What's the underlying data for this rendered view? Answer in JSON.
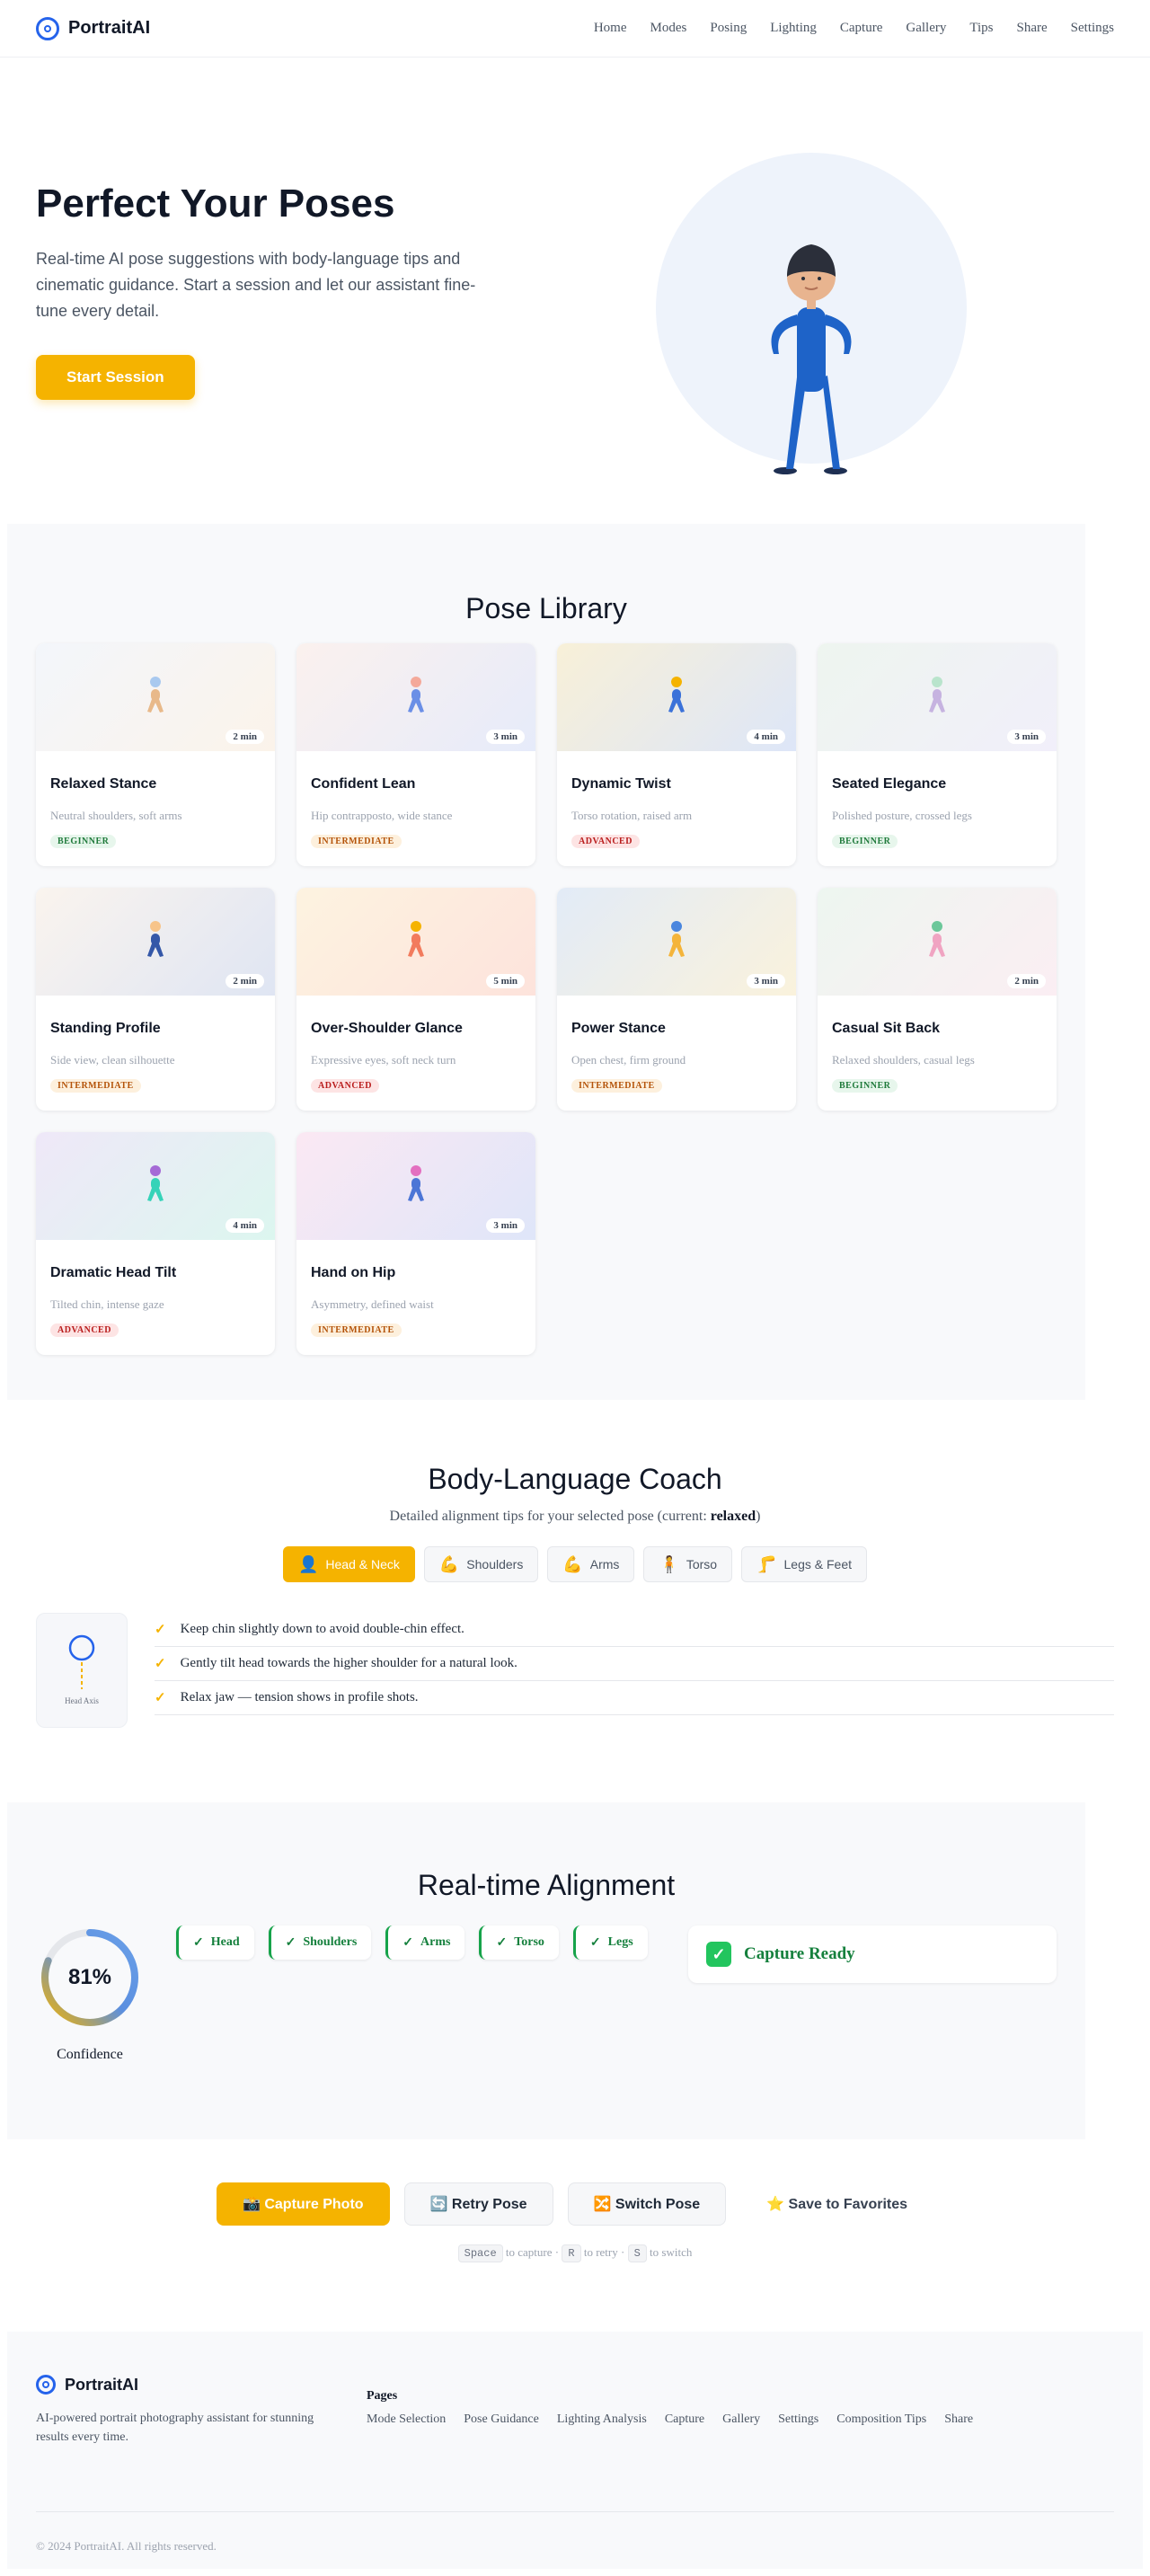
{
  "nav": {
    "brand": "PortraitAI",
    "links": [
      "Home",
      "Modes",
      "Posing",
      "Lighting",
      "Capture",
      "Gallery",
      "Tips",
      "Share",
      "Settings"
    ]
  },
  "hero": {
    "title": "Perfect Your Poses",
    "description": "Real-time AI pose suggestions with body-language tips and cinematic guidance. Start a session and let our assistant fine-tune every detail.",
    "cta": "Start Session"
  },
  "library": {
    "title": "Pose Library",
    "cards": [
      {
        "title": "Relaxed Stance",
        "desc": "Neutral shoulders, soft arms",
        "level": "BEGINNER",
        "duration": "2 min",
        "bg": [
          "#f3f6fb",
          "#fbf3ea"
        ],
        "head": "#a9c9ef",
        "body": "#e8b98a"
      },
      {
        "title": "Confident Lean",
        "desc": "Hip contrapposto, wide stance",
        "level": "INTERMEDIATE",
        "duration": "3 min",
        "bg": [
          "#fbf1ee",
          "#e6ebfa"
        ],
        "head": "#f4a99a",
        "body": "#6b8fe6"
      },
      {
        "title": "Dynamic Twist",
        "desc": "Torso rotation, raised arm",
        "level": "ADVANCED",
        "duration": "4 min",
        "bg": [
          "#f8f0d8",
          "#dde6f8"
        ],
        "head": "#f5b300",
        "body": "#3b72d9"
      },
      {
        "title": "Seated Elegance",
        "desc": "Polished posture, crossed legs",
        "level": "BEGINNER",
        "duration": "3 min",
        "bg": [
          "#eef5ef",
          "#f1effa"
        ],
        "head": "#b9e4cc",
        "body": "#c6b3e0"
      },
      {
        "title": "Standing Profile",
        "desc": "Side view, clean silhouette",
        "level": "INTERMEDIATE",
        "duration": "2 min",
        "bg": [
          "#faf4ee",
          "#dfe5f3"
        ],
        "head": "#f7c48a",
        "body": "#3457a8"
      },
      {
        "title": "Over-Shoulder Glance",
        "desc": "Expressive eyes, soft neck turn",
        "level": "ADVANCED",
        "duration": "5 min",
        "bg": [
          "#fdf3e0",
          "#fde3dc"
        ],
        "head": "#f5b300",
        "body": "#f27b5d"
      },
      {
        "title": "Power Stance",
        "desc": "Open chest, firm ground",
        "level": "INTERMEDIATE",
        "duration": "3 min",
        "bg": [
          "#e2ebf7",
          "#faf2dc"
        ],
        "head": "#4a86de",
        "body": "#f4b43a"
      },
      {
        "title": "Casual Sit Back",
        "desc": "Relaxed shoulders, casual legs",
        "level": "BEGINNER",
        "duration": "2 min",
        "bg": [
          "#edf6f0",
          "#fbeef3"
        ],
        "head": "#6cc79a",
        "body": "#f0a4c2"
      },
      {
        "title": "Dramatic Head Tilt",
        "desc": "Tilted chin, intense gaze",
        "level": "ADVANCED",
        "duration": "4 min",
        "bg": [
          "#efe8f8",
          "#dcf6ef"
        ],
        "head": "#a56ad6",
        "body": "#35d3b8"
      },
      {
        "title": "Hand on Hip",
        "desc": "Asymmetry, defined waist",
        "level": "INTERMEDIATE",
        "duration": "3 min",
        "bg": [
          "#fbe8f3",
          "#dfe6f9"
        ],
        "head": "#e36fc0",
        "body": "#4c75d6"
      }
    ]
  },
  "coach": {
    "title": "Body-Language Coach",
    "subtitle_prefix": "Detailed alignment tips for your selected pose (current: ",
    "current_pose": "relaxed",
    "subtitle_suffix": ")",
    "tabs": [
      {
        "label": "Head & Neck",
        "icon": "👤"
      },
      {
        "label": "Shoulders",
        "icon": "💪"
      },
      {
        "label": "Arms",
        "icon": "💪"
      },
      {
        "label": "Torso",
        "icon": "🧍"
      },
      {
        "label": "Legs & Feet",
        "icon": "🦵"
      }
    ],
    "axis_label": "Head Axis",
    "tips": [
      "Keep chin slightly down to avoid double-chin effect.",
      "Gently tilt head towards the higher shoulder for a natural look.",
      "Relax jaw — tension shows in profile shots."
    ]
  },
  "alignment": {
    "title": "Real-time Alignment",
    "confidence": 81,
    "confidence_text": "81%",
    "confidence_label": "Confidence",
    "checks": [
      "Head",
      "Shoulders",
      "Arms",
      "Torso",
      "Legs"
    ],
    "status": "Capture Ready"
  },
  "actions": {
    "buttons": [
      {
        "label": "📸 Capture Photo"
      },
      {
        "label": "🔄 Retry Pose"
      },
      {
        "label": "🔀 Switch Pose"
      },
      {
        "label": "⭐ Save to Favorites"
      }
    ],
    "shortcuts": [
      {
        "key": "Space",
        "text": "to capture"
      },
      {
        "key": "R",
        "text": "to retry"
      },
      {
        "key": "S",
        "text": "to switch"
      }
    ]
  },
  "footer": {
    "brand": "PortraitAI",
    "description": "AI-powered portrait photography assistant for stunning results every time.",
    "pages_title": "Pages",
    "pages": [
      "Mode Selection",
      "Pose Guidance",
      "Lighting Analysis",
      "Capture",
      "Gallery",
      "Settings",
      "Composition Tips",
      "Share"
    ],
    "copyright": "© 2024 PortraitAI. All rights reserved."
  },
  "colors": {
    "accent": "#f5b300",
    "brand": "#2563eb",
    "success": "#16a34a"
  }
}
